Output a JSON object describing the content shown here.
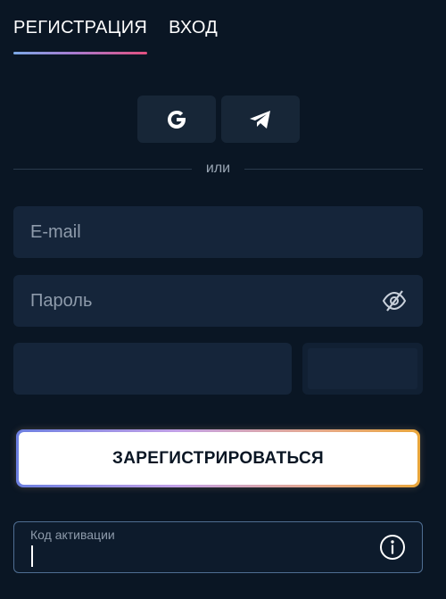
{
  "tabs": {
    "register_label": "РЕГИСТРАЦИЯ",
    "login_label": "ВХОД"
  },
  "social": {
    "google_icon": "google-icon",
    "telegram_icon": "telegram-icon"
  },
  "divider": {
    "text": "или"
  },
  "form": {
    "email_placeholder": "E-mail",
    "password_placeholder": "Пароль",
    "submit_label": "ЗАРЕГИСТРИРОВАТЬСЯ",
    "activation_label": "Код активации"
  },
  "colors": {
    "background": "#0a1624",
    "field": "#15253a",
    "accent_pink": "#e2507f",
    "accent_blue": "#7ba9e6"
  }
}
